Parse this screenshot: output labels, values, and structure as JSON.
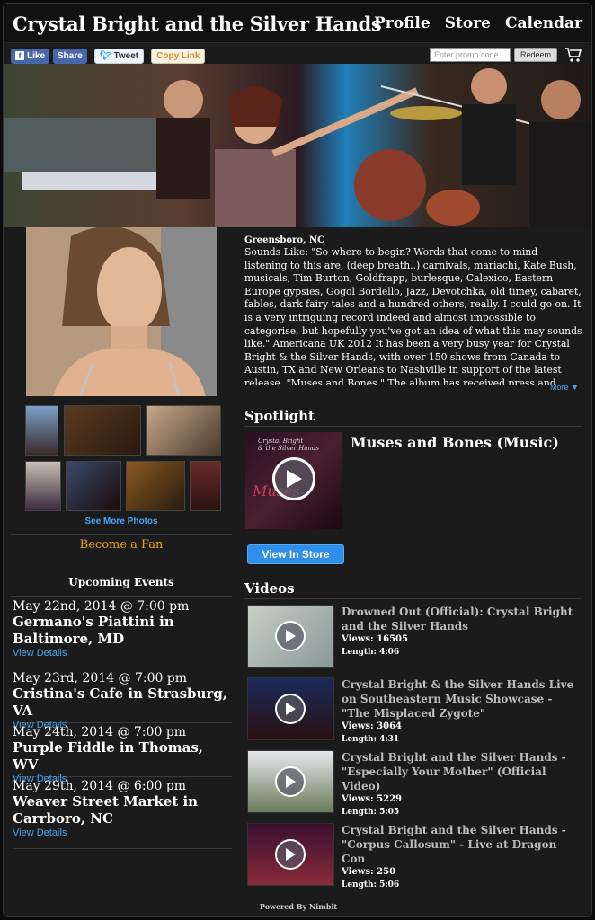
{
  "header": {
    "title": "Crystal Bright and the Silver Hands",
    "nav": [
      "Profile",
      "Store",
      "Calendar"
    ]
  },
  "sharebar": {
    "like": "Like",
    "share": "Share",
    "tweet": "Tweet",
    "copy_link": "Copy Link",
    "promo_placeholder": "Enter promo code.",
    "redeem": "Redeem"
  },
  "bio": {
    "location": "Greensboro, NC",
    "text": "Sounds Like: \"So where to begin? Words that come to mind listening to this are, (deep breath..) carnivals, mariachi, Kate Bush, musicals, Tim Burton, Goldfrapp, burlesque, Calexico, Eastern Europe gypsies, Gogol Bordello, Jazz, Devotchka, old timey, cabaret, fables, dark fairy tales and a hundred others, really. I could go on. It is a very intriguing record indeed and almost impossible to categorise, but hopefully you've got an idea of what this may sounds like.\" Americana UK 2012 It has been a very busy year for Crystal Bright & the Silver Hands, with over 150 shows from Canada to Austin, TX and New Orleans to Nashville in support of the latest release, \"Muses and Bones.\" The album has received press and glowing reviews in the US and",
    "more": "More"
  },
  "sidebar": {
    "see_more": "See More Photos",
    "become_fan": "Become a Fan",
    "events_heading": "Upcoming Events",
    "view_details": "View Details",
    "events": [
      {
        "date": "May 22nd, 2014 @ 7:00 pm",
        "venue": "Germano's Piattini in Baltimore, MD"
      },
      {
        "date": "May 23rd, 2014 @ 7:00 pm",
        "venue": "Cristina's Cafe in Strasburg, VA"
      },
      {
        "date": "May 24th, 2014 @ 7:00 pm",
        "venue": "Purple Fiddle in Thomas, WV"
      },
      {
        "date": "May 29th, 2014 @ 6:00 pm",
        "venue": "Weaver Street Market in Carrboro, NC"
      }
    ]
  },
  "spotlight": {
    "heading": "Spotlight",
    "title": "Muses and Bones (Music)",
    "cover_line1": "Crystal Bright",
    "cover_line2": "& the Silver Hands",
    "cover_script": "Muses",
    "button": "View In Store"
  },
  "videos": {
    "heading": "Videos",
    "views_label": "Views:",
    "length_label": "Length:",
    "items": [
      {
        "title": "Drowned Out (Official): Crystal Bright and the Silver Hands",
        "views": "16505",
        "length": "4:06"
      },
      {
        "title": "Crystal Bright & the Silver Hands Live on Southeastern Music Showcase - \"The Misplaced Zygote\"",
        "views": "3064",
        "length": "4:31"
      },
      {
        "title": "Crystal Bright and the Silver Hands - \"Especially Your Mother\" (Official Video)",
        "views": "5229",
        "length": "5:05"
      },
      {
        "title": "Crystal Bright and the Silver Hands - \"Corpus Callosum\" - Live at Dragon Con",
        "views": "250",
        "length": "5:06"
      }
    ]
  },
  "footer": {
    "powered": "Powered By Nimbit"
  }
}
